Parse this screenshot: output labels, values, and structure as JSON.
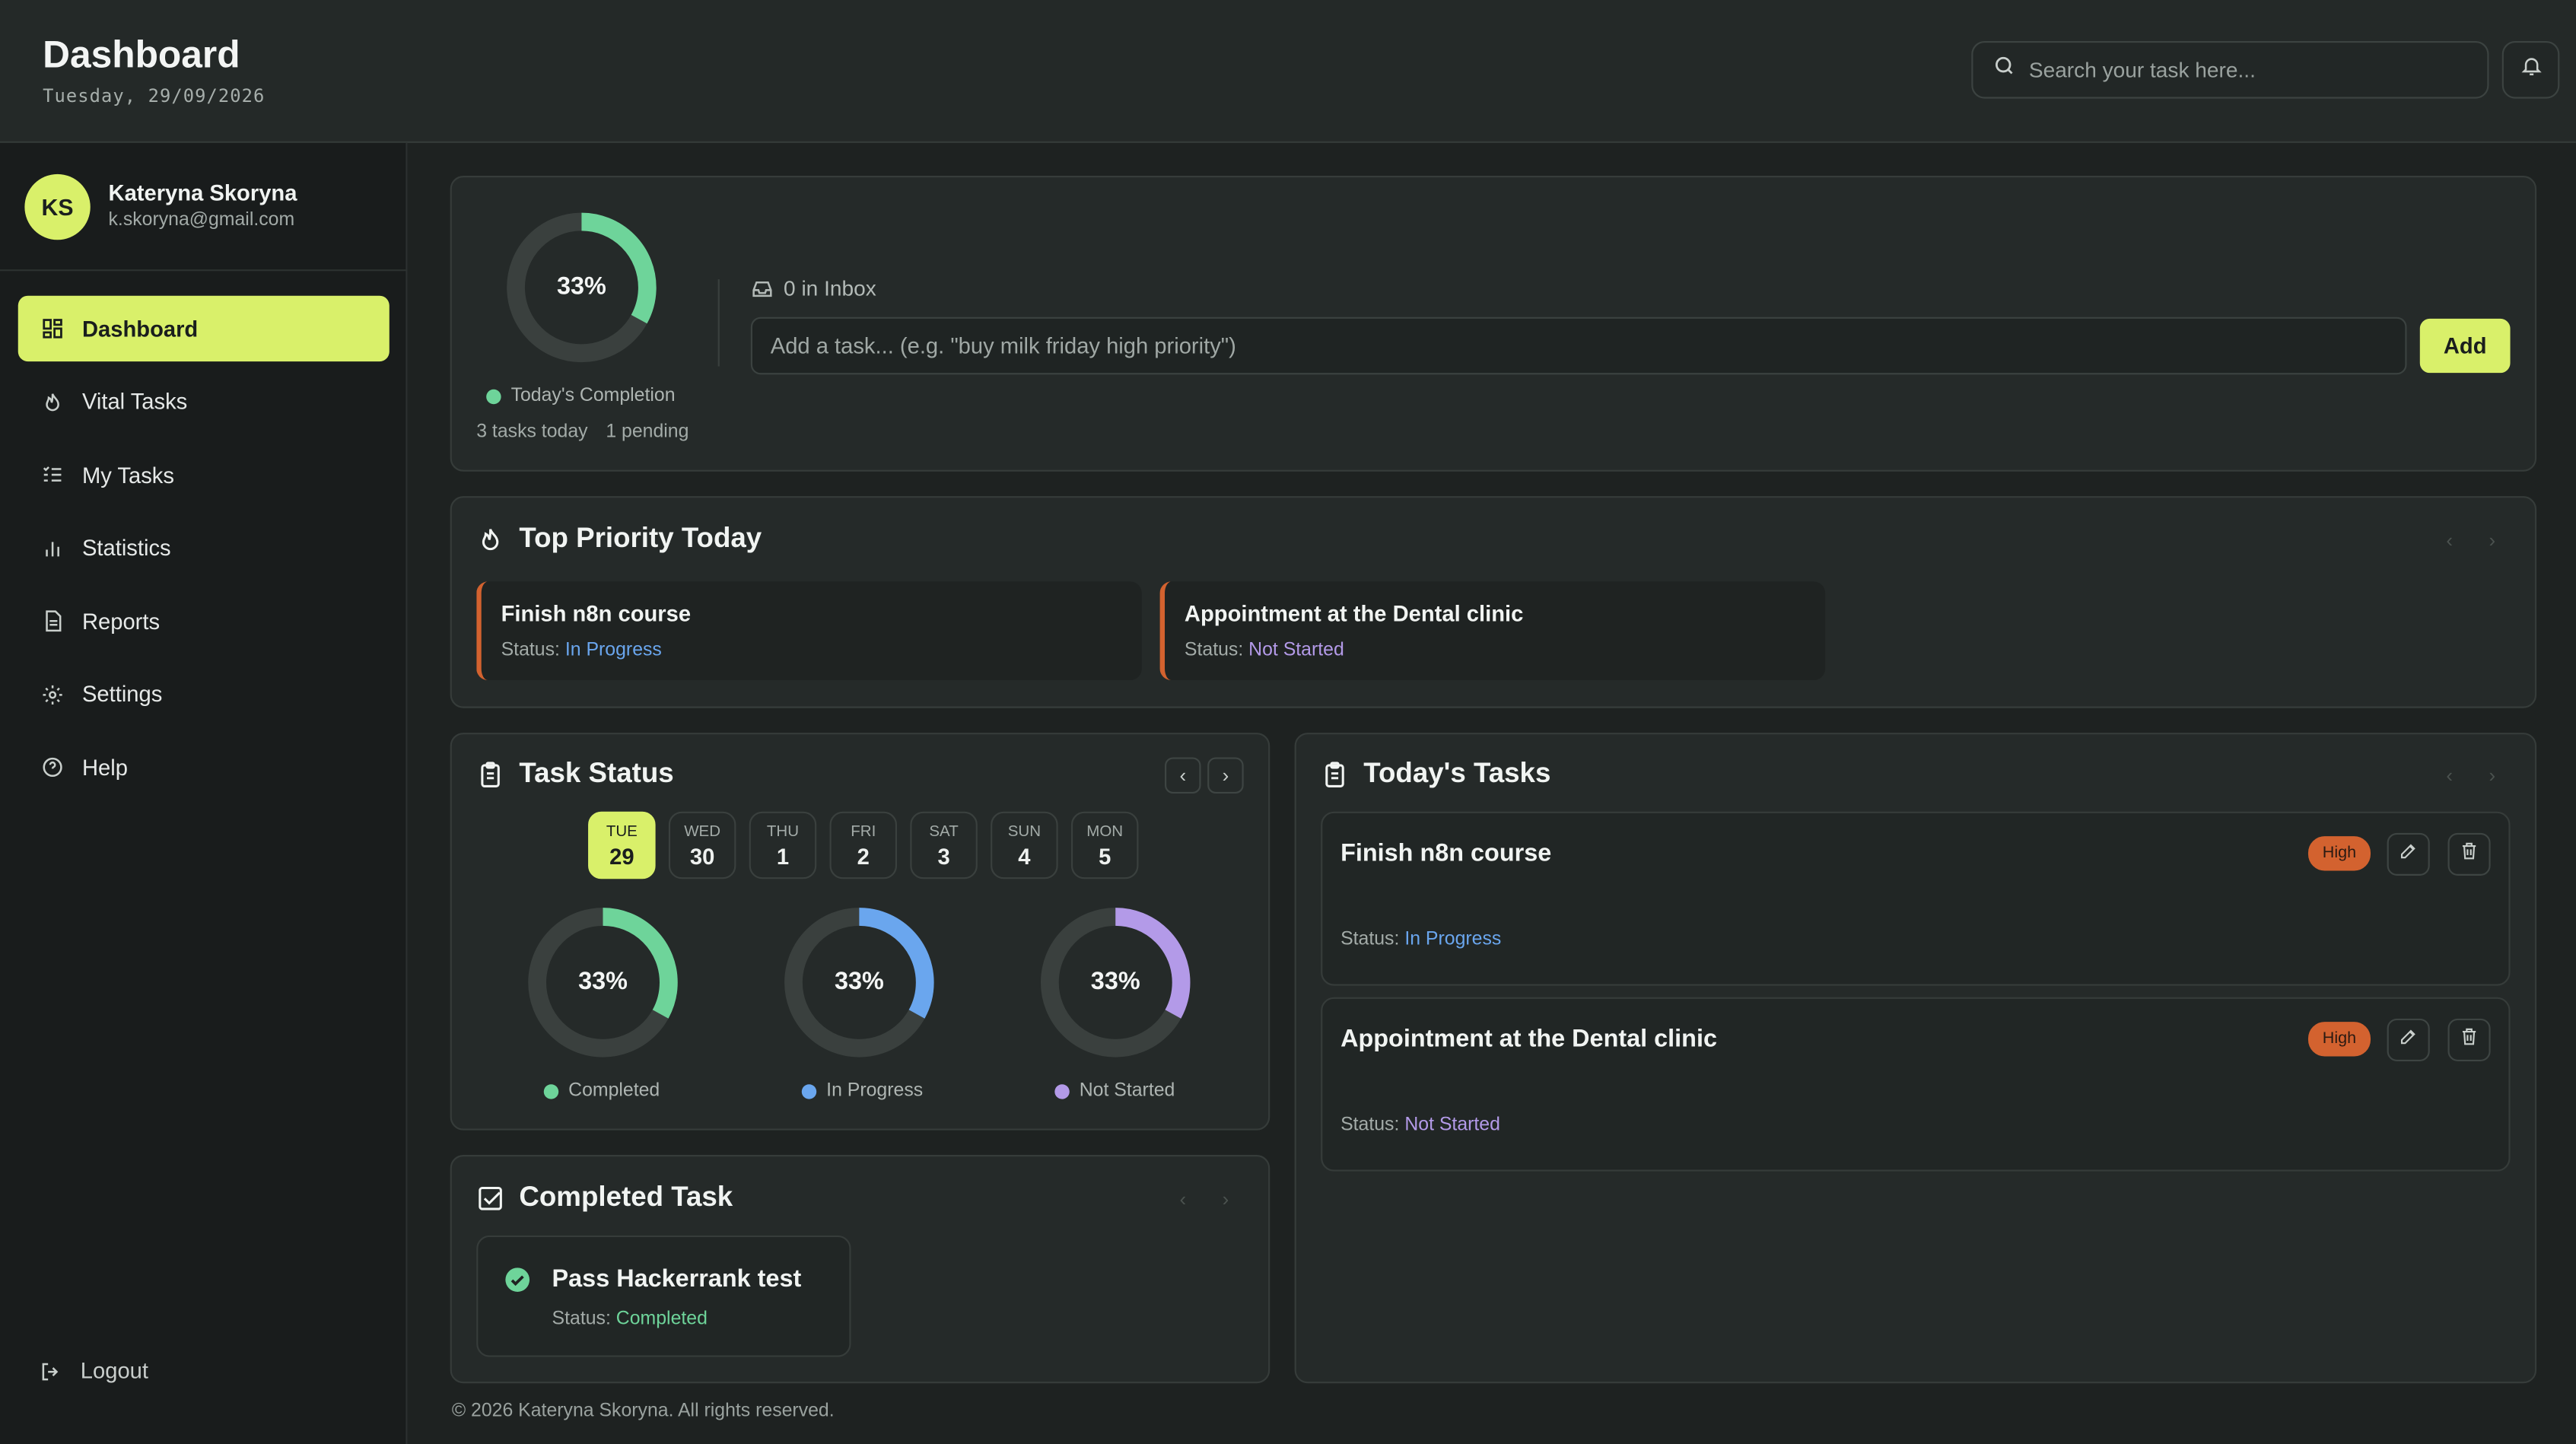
{
  "header": {
    "title": "Dashboard",
    "date": "Tuesday, 29/09/2026",
    "search_placeholder": "Search your task here..."
  },
  "user": {
    "initials": "KS",
    "name": "Kateryna Skoryna",
    "email": "k.skoryna@gmail.com"
  },
  "sidebar": {
    "items": [
      {
        "label": "Dashboard",
        "icon": "grid-icon",
        "active": true
      },
      {
        "label": "Vital Tasks",
        "icon": "flame-icon"
      },
      {
        "label": "My Tasks",
        "icon": "checklist-icon"
      },
      {
        "label": "Statistics",
        "icon": "bar-chart-icon"
      },
      {
        "label": "Reports",
        "icon": "document-icon"
      },
      {
        "label": "Settings",
        "icon": "gear-icon"
      },
      {
        "label": "Help",
        "icon": "question-icon"
      }
    ],
    "logout_label": "Logout"
  },
  "overview": {
    "completion_percent": 33,
    "completion_text": "33%",
    "completion_label": "Today's Completion",
    "tasks_today": "3 tasks today",
    "pending": "1 pending",
    "inbox": "0 in Inbox",
    "input_placeholder": "Add a task... (e.g. \"buy milk friday high priority\")",
    "add_label": "Add"
  },
  "priority": {
    "title": "Top Priority Today",
    "items": [
      {
        "title": "Finish n8n course",
        "status_label": "Status:",
        "status": "In Progress"
      },
      {
        "title": "Appointment at the Dental clinic",
        "status_label": "Status:",
        "status": "Not Started"
      }
    ]
  },
  "task_status": {
    "title": "Task Status",
    "days": [
      {
        "name": "TUE",
        "num": "29",
        "selected": true
      },
      {
        "name": "WED",
        "num": "30"
      },
      {
        "name": "THU",
        "num": "1"
      },
      {
        "name": "FRI",
        "num": "2"
      },
      {
        "name": "SAT",
        "num": "3"
      },
      {
        "name": "SUN",
        "num": "4"
      },
      {
        "name": "MON",
        "num": "5"
      }
    ],
    "rings": [
      {
        "label": "Completed",
        "percent": 33,
        "text": "33%",
        "color": "#6ed49a"
      },
      {
        "label": "In Progress",
        "percent": 33,
        "text": "33%",
        "color": "#6aa6ee"
      },
      {
        "label": "Not Started",
        "percent": 33,
        "text": "33%",
        "color": "#b39ae8"
      }
    ]
  },
  "completed": {
    "title": "Completed Task",
    "items": [
      {
        "title": "Pass Hackerrank test",
        "status_label": "Status:",
        "status": "Completed"
      }
    ]
  },
  "today": {
    "title": "Today's Tasks",
    "items": [
      {
        "title": "Finish n8n course",
        "priority": "High",
        "status_label": "Status:",
        "status": "In Progress"
      },
      {
        "title": "Appointment at the Dental clinic",
        "priority": "High",
        "status_label": "Status:",
        "status": "Not Started"
      }
    ]
  },
  "footer": "© 2026 Kateryna Skoryna. All rights reserved.",
  "colors": {
    "accent": "#d9f06a",
    "priority_high": "#d3622f",
    "in_progress": "#6aa6ee",
    "not_started": "#b39ae8",
    "completed": "#6ed49a"
  }
}
